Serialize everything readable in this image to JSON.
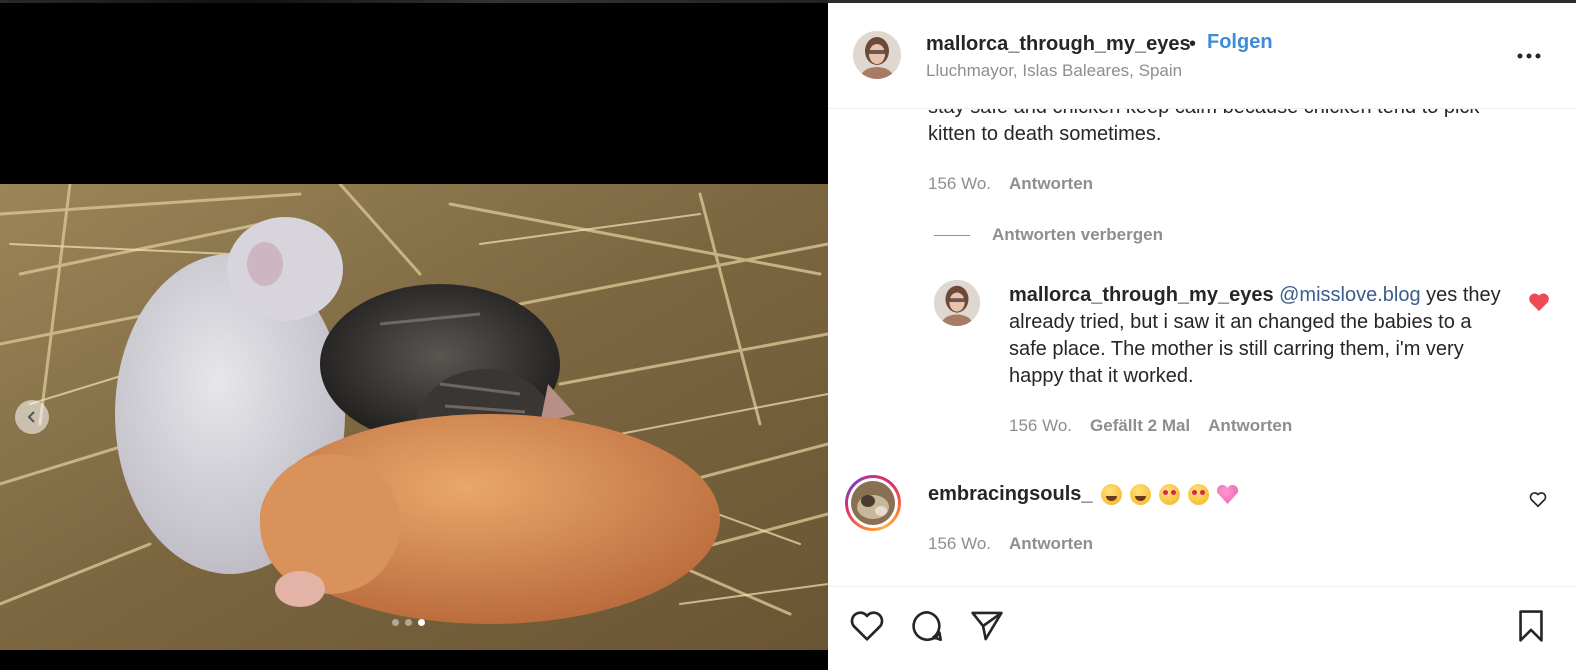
{
  "post": {
    "username": "mallorca_through_my_eyes",
    "separator": "•",
    "follow_label": "Folgen",
    "location": "Lluchmayor, Islas Baleares, Spain",
    "more_icon": "more-horizontal-icon"
  },
  "media": {
    "carousel_dots": 3,
    "active_dot": 3,
    "prev_icon": "chevron-left-icon"
  },
  "comments": {
    "previous": {
      "text": "stay safe and chicken keep calm because chicken tend to pick kitten to death sometimes.",
      "age": "156 Wo.",
      "reply_label": "Antworten"
    },
    "hide_replies_label": "Antworten verbergen",
    "reply": {
      "username": "mallorca_through_my_eyes",
      "mention": "@misslove.blog",
      "text": "yes they already tried, but i saw it an changed the babies to a safe place. The mother is still carring them, i'm very happy that it worked.",
      "age": "156 Wo.",
      "likes": "Gefällt 2 Mal",
      "reply_label": "Antworten",
      "liked": true
    },
    "second": {
      "username": "embracingsouls_",
      "emojis": [
        "rolling-laughing",
        "joy",
        "star-struck",
        "heart-eyes",
        "pink-heart"
      ],
      "age": "156 Wo.",
      "reply_label": "Antworten",
      "liked": false
    }
  },
  "actions": {
    "icons": [
      "heart-icon",
      "comment-icon",
      "share-icon",
      "bookmark-icon"
    ]
  },
  "colors": {
    "link_blue": "#3d8bd9",
    "mention": "#3b5d8f",
    "like_red": "#ed4956",
    "muted": "#8e8e8e",
    "text": "#262626"
  }
}
